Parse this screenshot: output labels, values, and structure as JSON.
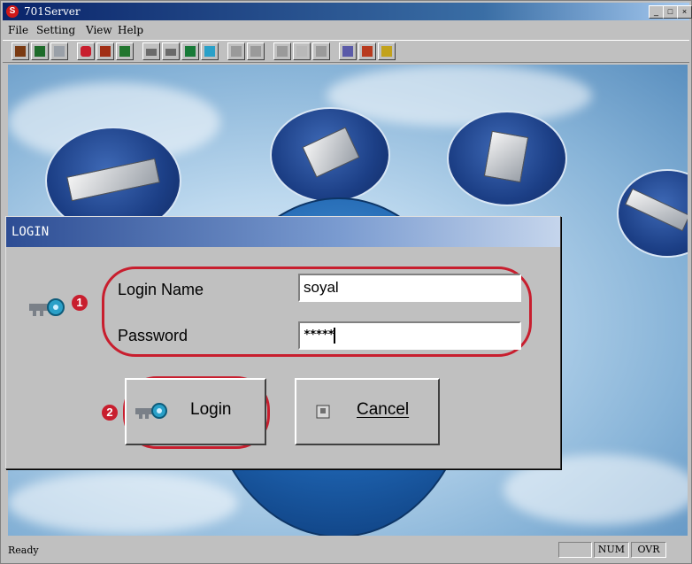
{
  "app": {
    "title": "701Server",
    "icon_letter": "S",
    "window_buttons": [
      "_",
      "□",
      "×"
    ]
  },
  "menu": [
    "File",
    "Setting",
    "View",
    "Help"
  ],
  "toolbar": {
    "icons": [
      "map-icon",
      "users-icon",
      "grid-icon",
      "heart-icon",
      "people-icon",
      "chart-icon",
      "card-icon",
      "door-icon",
      "monitor-icon",
      "screen-icon",
      "copy-icon",
      "list-icon",
      "print-icon",
      "check-icon",
      "save-icon",
      "undo-icon",
      "edit-icon",
      "help-icon"
    ]
  },
  "dialog": {
    "title": "LOGIN",
    "login_name_label": "Login Name",
    "login_name_value": "soyal",
    "password_label": "Password",
    "password_value": "*****",
    "login_button": "Login",
    "cancel_button": "Cancel",
    "badge_1": "1",
    "badge_2": "2"
  },
  "status": {
    "text": "Ready",
    "num": "NUM",
    "ovr": "OVR"
  },
  "colors": {
    "annotation_red": "#c81e2e",
    "title_blue": "#0a246a"
  }
}
